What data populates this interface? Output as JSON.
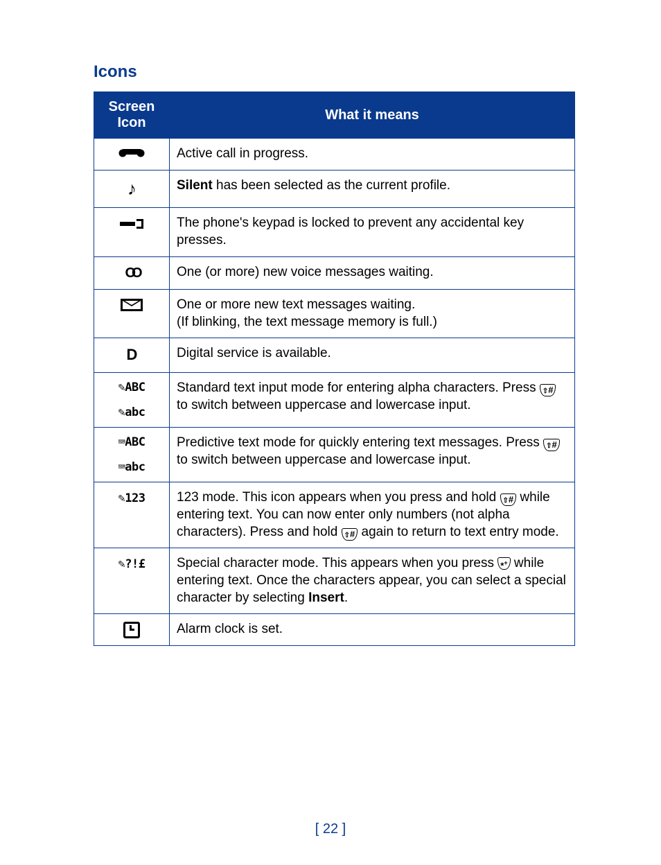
{
  "title": "Icons",
  "page_number": "[ 22 ]",
  "headers": {
    "icon": "Screen Icon",
    "meaning": "What it means"
  },
  "rows": [
    {
      "icon_name": "active-call-icon",
      "icon_html": "<span class='ic ic-call'></span>",
      "html": "Active call in progress."
    },
    {
      "icon_name": "silent-profile-icon",
      "icon_html": "<span class='ic ic-silent'>♪</span>",
      "html": "<span class='b'>Silent</span> has been selected as the current profile."
    },
    {
      "icon_name": "keypad-locked-icon",
      "icon_html": "<span class='ic ic-lock'></span>",
      "html": "The phone's keypad is locked to prevent any accidental key presses."
    },
    {
      "icon_name": "voicemail-icon",
      "icon_html": "<span class='ic ic-vm'>OO</span>",
      "html": "One (or more) new voice messages waiting."
    },
    {
      "icon_name": "text-message-icon",
      "icon_html": "<span class='ic ic-msg'></span>",
      "html": "One or more new text messages waiting.<br>(If blinking, the text message memory is full.)"
    },
    {
      "icon_name": "digital-service-icon",
      "icon_html": "<span class='ic ic-D'>D</span>",
      "html": "Digital service is available."
    },
    {
      "icon_name": "standard-text-mode-icon",
      "icon_html": "<span class='stack ic-txt'>✎ABC</span><span class='stack' style='height:14px'></span><span class='stack ic-txt'>✎abc</span>",
      "html": "Standard text input mode for entering alpha characters. Press <span class='key-hash'>#</span> to switch between uppercase and lowercase input."
    },
    {
      "icon_name": "predictive-text-mode-icon",
      "icon_html": "<span class='stack ic-txt'>⌨ABC</span><span class='stack' style='height:14px'></span><span class='stack ic-txt'>⌨abc</span>",
      "html": "Predictive text mode for quickly entering text messages. Press <span class='key-hash'>#</span> to switch between uppercase and lowercase input."
    },
    {
      "icon_name": "number-mode-icon",
      "icon_html": "<span class='ic-txt'>✎123</span>",
      "html": "123 mode. This icon appears when you press and hold <span class='key-hash'>#</span> while entering text. You can now enter only numbers (not alpha characters). Press and hold <span class='key-hash'>#</span> again to return to text entry mode."
    },
    {
      "icon_name": "special-char-mode-icon",
      "icon_html": "<span class='ic-txt'>✎?!£</span>",
      "html": "Special character mode. This appears when you press <span class='key-star'>*<sup style='font-size:9px'>+</sup></span> while entering text. Once the characters appear, you can select a special character by selecting <span class='b'>Insert</span>."
    },
    {
      "icon_name": "alarm-set-icon",
      "icon_html": "<span class='ic ic-alarm'></span>",
      "html": "Alarm clock is set."
    }
  ]
}
